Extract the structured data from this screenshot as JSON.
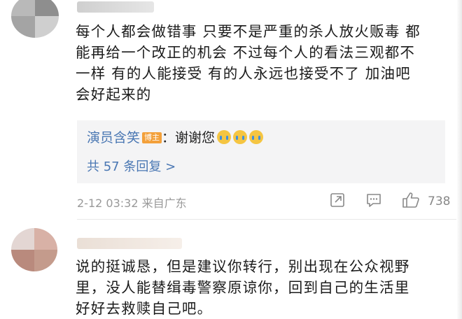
{
  "comments": [
    {
      "text_lines": [
        "每个人都会做错事 只要不是严重的杀人放火贩毒 都",
        "能再给一个改正的机会 不过每个人的看法三观都不",
        "一样 有的人能接受 有的人永远也接受不了 加油吧",
        "会好起来的"
      ],
      "reply": {
        "author": "演员含笑",
        "badge": "博主",
        "text": "：谢谢您",
        "emoji_icons": [
          "crying-face-icon",
          "crying-face-icon",
          "crying-face-icon"
        ],
        "more_label": "共 57 条回复 >"
      },
      "meta": "2-12 03:32  来自广东",
      "like_count": "738",
      "action_icons": [
        "share-icon",
        "comment-icon",
        "like-icon"
      ]
    },
    {
      "text_lines": [
        "说的挺诚恳，但是建议你转行，别出现在公众视野",
        "里，没人能替缉毒警察原谅你，回到自己的生活里",
        "好好去救赎自己吧。"
      ]
    }
  ],
  "colors": {
    "link": "#4a77b3",
    "badge": "#f3a03a",
    "meta": "#999999"
  }
}
